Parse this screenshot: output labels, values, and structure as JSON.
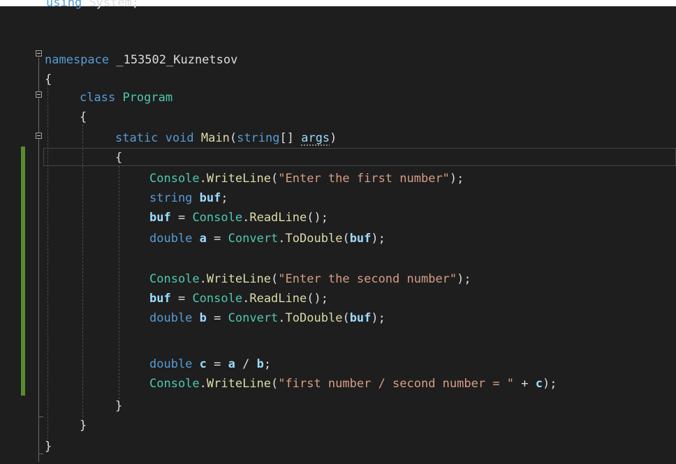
{
  "editor": {
    "lines": [
      [
        {
          "t": "using",
          "c": "kw"
        },
        {
          "t": " ",
          "c": "pl"
        },
        {
          "t": "System",
          "c": "ns"
        },
        {
          "t": ";",
          "c": "pl"
        }
      ],
      [],
      [
        {
          "t": "namespace",
          "c": "kw"
        },
        {
          "t": " _153502_Kuznetsov",
          "c": "ns"
        }
      ],
      [
        {
          "t": "{",
          "c": "pl"
        }
      ],
      [
        {
          "t": "class",
          "c": "kw"
        },
        {
          "t": " ",
          "c": "pl"
        },
        {
          "t": "Program",
          "c": "ty"
        }
      ],
      [
        {
          "t": "{",
          "c": "pl"
        }
      ],
      [
        {
          "t": "static",
          "c": "kw"
        },
        {
          "t": " ",
          "c": "pl"
        },
        {
          "t": "void",
          "c": "kw"
        },
        {
          "t": " ",
          "c": "pl"
        },
        {
          "t": "Main",
          "c": "fn"
        },
        {
          "t": "(",
          "c": "pl"
        },
        {
          "t": "string",
          "c": "kw"
        },
        {
          "t": "[] ",
          "c": "pl"
        },
        {
          "t": "args",
          "c": "par sq"
        },
        {
          "t": ")",
          "c": "pl"
        }
      ],
      [
        {
          "t": "{",
          "c": "pl"
        }
      ],
      [
        {
          "t": "Console",
          "c": "ty"
        },
        {
          "t": ".",
          "c": "pl"
        },
        {
          "t": "WriteLine",
          "c": "fn"
        },
        {
          "t": "(",
          "c": "pl"
        },
        {
          "t": "\"Enter the first number\"",
          "c": "str"
        },
        {
          "t": ");",
          "c": "pl"
        }
      ],
      [
        {
          "t": "string",
          "c": "kw"
        },
        {
          "t": " ",
          "c": "pl"
        },
        {
          "t": "buf",
          "c": "var"
        },
        {
          "t": ";",
          "c": "pl"
        }
      ],
      [
        {
          "t": "buf",
          "c": "var"
        },
        {
          "t": " = ",
          "c": "pl"
        },
        {
          "t": "Console",
          "c": "ty"
        },
        {
          "t": ".",
          "c": "pl"
        },
        {
          "t": "ReadLine",
          "c": "fn"
        },
        {
          "t": "();",
          "c": "pl"
        }
      ],
      [
        {
          "t": "double",
          "c": "kw"
        },
        {
          "t": " ",
          "c": "pl"
        },
        {
          "t": "a",
          "c": "var"
        },
        {
          "t": " = ",
          "c": "pl"
        },
        {
          "t": "Convert",
          "c": "ty"
        },
        {
          "t": ".",
          "c": "pl"
        },
        {
          "t": "ToDouble",
          "c": "fn"
        },
        {
          "t": "(",
          "c": "pl"
        },
        {
          "t": "buf",
          "c": "var"
        },
        {
          "t": ");",
          "c": "pl"
        }
      ],
      [],
      [
        {
          "t": "Console",
          "c": "ty"
        },
        {
          "t": ".",
          "c": "pl"
        },
        {
          "t": "WriteLine",
          "c": "fn"
        },
        {
          "t": "(",
          "c": "pl"
        },
        {
          "t": "\"Enter the second number\"",
          "c": "str"
        },
        {
          "t": ");",
          "c": "pl"
        }
      ],
      [
        {
          "t": "buf",
          "c": "var"
        },
        {
          "t": " = ",
          "c": "pl"
        },
        {
          "t": "Console",
          "c": "ty"
        },
        {
          "t": ".",
          "c": "pl"
        },
        {
          "t": "ReadLine",
          "c": "fn"
        },
        {
          "t": "();",
          "c": "pl"
        }
      ],
      [
        {
          "t": "double",
          "c": "kw"
        },
        {
          "t": " ",
          "c": "pl"
        },
        {
          "t": "b",
          "c": "var"
        },
        {
          "t": " = ",
          "c": "pl"
        },
        {
          "t": "Convert",
          "c": "ty"
        },
        {
          "t": ".",
          "c": "pl"
        },
        {
          "t": "ToDouble",
          "c": "fn"
        },
        {
          "t": "(",
          "c": "pl"
        },
        {
          "t": "buf",
          "c": "var"
        },
        {
          "t": ");",
          "c": "pl"
        }
      ],
      [],
      [
        {
          "t": "double",
          "c": "kw"
        },
        {
          "t": " ",
          "c": "pl"
        },
        {
          "t": "c",
          "c": "var"
        },
        {
          "t": " = ",
          "c": "pl"
        },
        {
          "t": "a",
          "c": "var"
        },
        {
          "t": " / ",
          "c": "pl"
        },
        {
          "t": "b",
          "c": "var"
        },
        {
          "t": ";",
          "c": "pl"
        }
      ],
      [
        {
          "t": "Console",
          "c": "ty"
        },
        {
          "t": ".",
          "c": "pl"
        },
        {
          "t": "WriteLine",
          "c": "fn"
        },
        {
          "t": "(",
          "c": "pl"
        },
        {
          "t": "\"first number / second number = \"",
          "c": "str"
        },
        {
          "t": " + ",
          "c": "pl"
        },
        {
          "t": "c",
          "c": "var"
        },
        {
          "t": ");",
          "c": "pl"
        }
      ],
      [
        {
          "t": "}",
          "c": "pl"
        }
      ],
      [
        {
          "t": "}",
          "c": "pl"
        }
      ],
      [
        {
          "t": "}",
          "c": "pl"
        }
      ]
    ]
  }
}
